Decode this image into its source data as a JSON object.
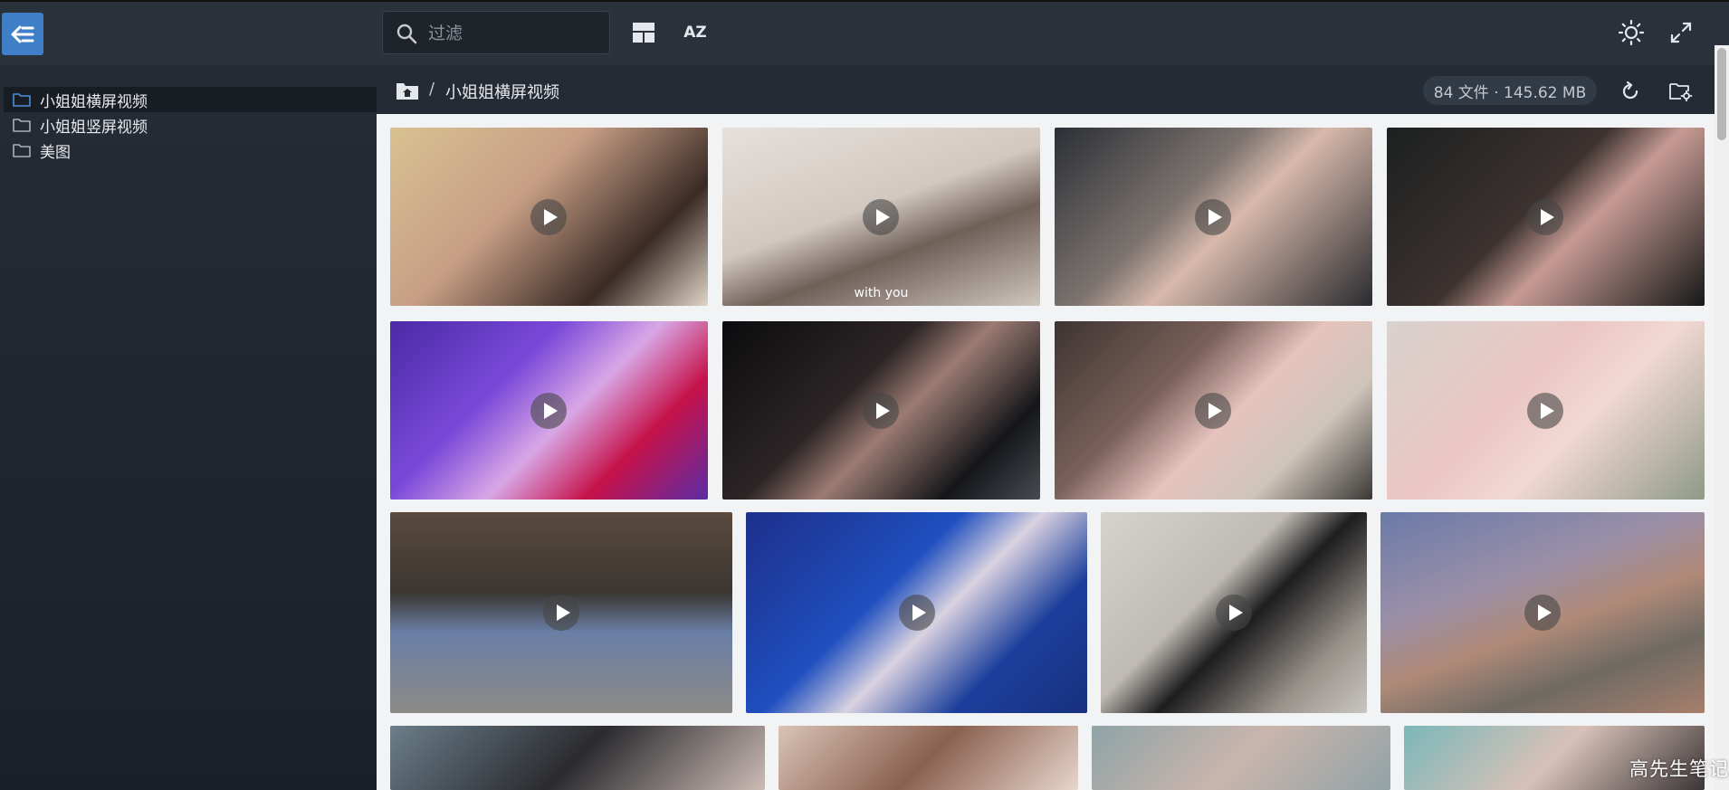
{
  "toolbar": {
    "search_placeholder": "过滤",
    "sort_label": "AZ",
    "back_icon": "arrow-left-list-icon",
    "layout_icon": "layout-icon",
    "theme_icon": "sun-icon",
    "fullscreen_icon": "expand-icon"
  },
  "sidebar": {
    "items": [
      {
        "label": "小姐姐横屏视频",
        "active": true
      },
      {
        "label": "小姐姐竖屏视频",
        "active": false
      },
      {
        "label": "美图",
        "active": false
      }
    ]
  },
  "breadcrumb": {
    "separator": "/",
    "current": "小姐姐横屏视频"
  },
  "stats": "84 文件 · 145.62 MB",
  "tiles": [
    {
      "caption": ""
    },
    {
      "caption": "with you"
    },
    {
      "caption": ""
    },
    {
      "caption": ""
    },
    {
      "caption": ""
    },
    {
      "caption": ""
    },
    {
      "caption": ""
    },
    {
      "caption": ""
    },
    {
      "caption": ""
    },
    {
      "caption": ""
    },
    {
      "caption": ""
    },
    {
      "caption": ""
    },
    {
      "caption": ""
    },
    {
      "caption": ""
    },
    {
      "caption": ""
    },
    {
      "caption": ""
    }
  ],
  "watermark": "高先生笔记",
  "colors": {
    "accent": "#3e7fc7",
    "toolbar_bg": "#2b313a",
    "sidebar_bg": "#1f252d",
    "content_bg": "#f2f3f5"
  }
}
